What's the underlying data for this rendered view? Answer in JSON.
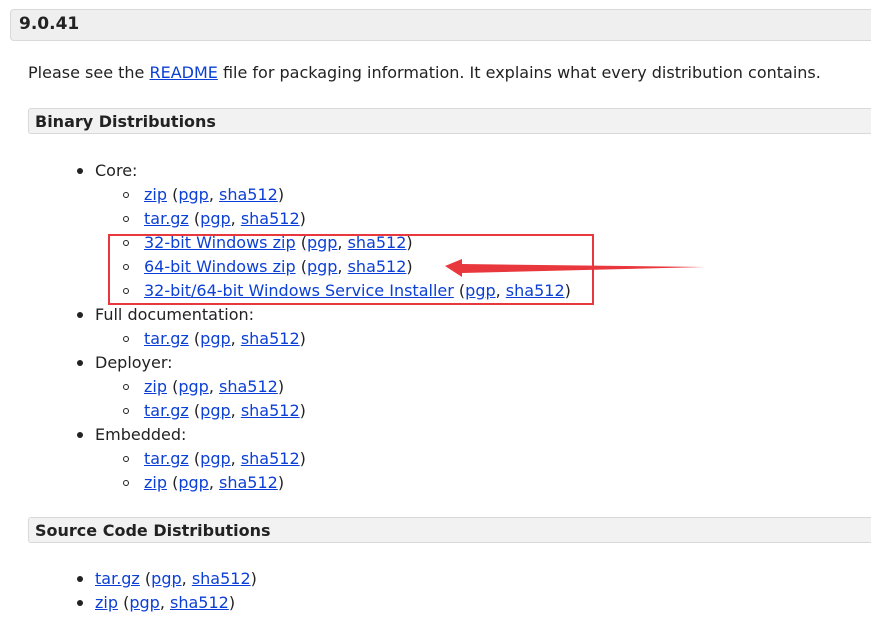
{
  "version": "9.0.41",
  "intro": {
    "before": "Please see the ",
    "link": "README",
    "after": " file for packaging information. It explains what every distribution contains."
  },
  "binary": {
    "title": "Binary Distributions",
    "core_label": "Core:",
    "core_items": [
      {
        "link": "zip",
        "pgp": "pgp",
        "sha": "sha512"
      },
      {
        "link": "tar.gz",
        "pgp": "pgp",
        "sha": "sha512"
      },
      {
        "link": "32-bit Windows zip",
        "pgp": "pgp",
        "sha": "sha512"
      },
      {
        "link": "64-bit Windows zip",
        "pgp": "pgp",
        "sha": "sha512"
      },
      {
        "link": "32-bit/64-bit Windows Service Installer",
        "pgp": "pgp",
        "sha": "sha512"
      }
    ],
    "fulldoc_label": "Full documentation:",
    "fulldoc_items": [
      {
        "link": "tar.gz",
        "pgp": "pgp",
        "sha": "sha512"
      }
    ],
    "deployer_label": "Deployer:",
    "deployer_items": [
      {
        "link": "zip",
        "pgp": "pgp",
        "sha": "sha512"
      },
      {
        "link": "tar.gz",
        "pgp": "pgp",
        "sha": "sha512"
      }
    ],
    "embedded_label": "Embedded:",
    "embedded_items": [
      {
        "link": "tar.gz",
        "pgp": "pgp",
        "sha": "sha512"
      },
      {
        "link": "zip",
        "pgp": "pgp",
        "sha": "sha512"
      }
    ]
  },
  "source": {
    "title": "Source Code Distributions",
    "items": [
      {
        "link": "tar.gz",
        "pgp": "pgp",
        "sha": "sha512"
      },
      {
        "link": "zip",
        "pgp": "pgp",
        "sha": "sha512"
      }
    ]
  },
  "colors": {
    "link": "#0b3fd6",
    "annotation": "#e8383d"
  }
}
